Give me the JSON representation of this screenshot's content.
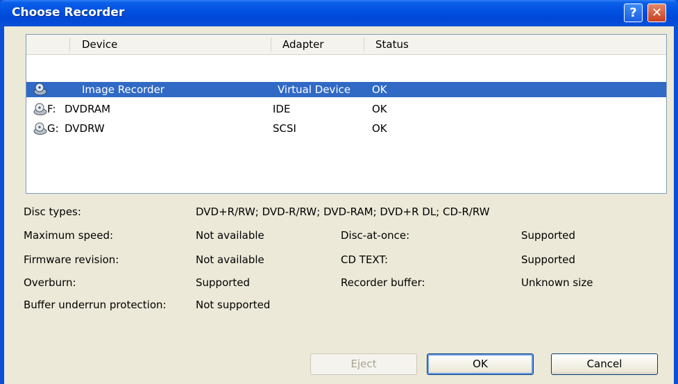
{
  "window": {
    "title": "Choose Recorder"
  },
  "titlebar_buttons": {
    "help": "?",
    "close": "✕"
  },
  "table": {
    "columns": [
      "Device",
      "Adapter",
      "Status"
    ],
    "rows": [
      {
        "drive": "",
        "device": "Image Recorder",
        "adapter": "Virtual Device",
        "status": "OK",
        "icon": "image-recorder-icon"
      },
      {
        "drive": "F:",
        "device": "DVDRAM",
        "adapter": "IDE",
        "status": "OK",
        "icon": "optical-drive-icon"
      },
      {
        "drive": "G:",
        "device": "DVDRW",
        "adapter": "SCSI",
        "status": "OK",
        "icon": "optical-drive-icon"
      }
    ]
  },
  "properties": {
    "disc_types_label": "Disc types:",
    "disc_types_value": "DVD+R/RW; DVD-R/RW; DVD-RAM; DVD+R DL; CD-R/RW",
    "max_speed_label": "Maximum speed:",
    "max_speed_value": "Not available",
    "firmware_label": "Firmware revision:",
    "firmware_value": "Not available",
    "overburn_label": "Overburn:",
    "overburn_value": "Supported",
    "buffer_underrun_label": "Buffer underrun protection:",
    "buffer_underrun_value": "Not supported",
    "dao_label": "Disc-at-once:",
    "dao_value": "Supported",
    "cdtext_label": "CD TEXT:",
    "cdtext_value": "Supported",
    "recorder_buffer_label": "Recorder buffer:",
    "recorder_buffer_value": "Unknown size"
  },
  "buttons": {
    "eject": "Eject",
    "ok": "OK",
    "cancel": "Cancel"
  },
  "colors": {
    "titlebar": "#0a4fd6",
    "selection": "#316ac5",
    "dialog": "#ece9d8"
  }
}
